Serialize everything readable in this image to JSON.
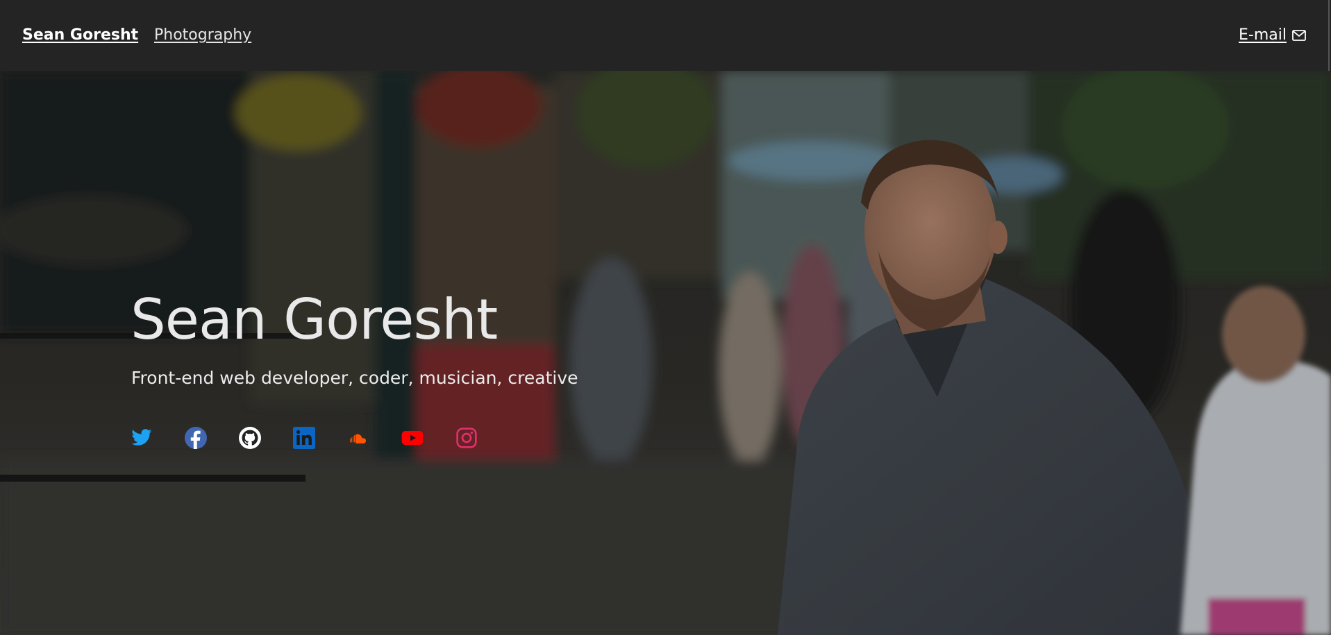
{
  "nav": {
    "brand": "Sean Goresht",
    "photography": "Photography",
    "email": "E-mail"
  },
  "hero": {
    "title": "Sean Goresht",
    "subtitle": "Front-end web developer, coder, musician, creative"
  },
  "social": [
    {
      "name": "twitter-icon",
      "color": "#1da1f2"
    },
    {
      "name": "facebook-icon",
      "color": "#4267b2"
    },
    {
      "name": "github-icon",
      "color": "#ffffff"
    },
    {
      "name": "linkedin-icon",
      "color": "#0a66c2"
    },
    {
      "name": "soundcloud-icon",
      "color": "#ff5500"
    },
    {
      "name": "youtube-icon",
      "color": "#ff0000"
    },
    {
      "name": "instagram-icon",
      "color": "#e1306c"
    }
  ],
  "colors": {
    "topbar": "#242424",
    "text": "#ffffff"
  }
}
